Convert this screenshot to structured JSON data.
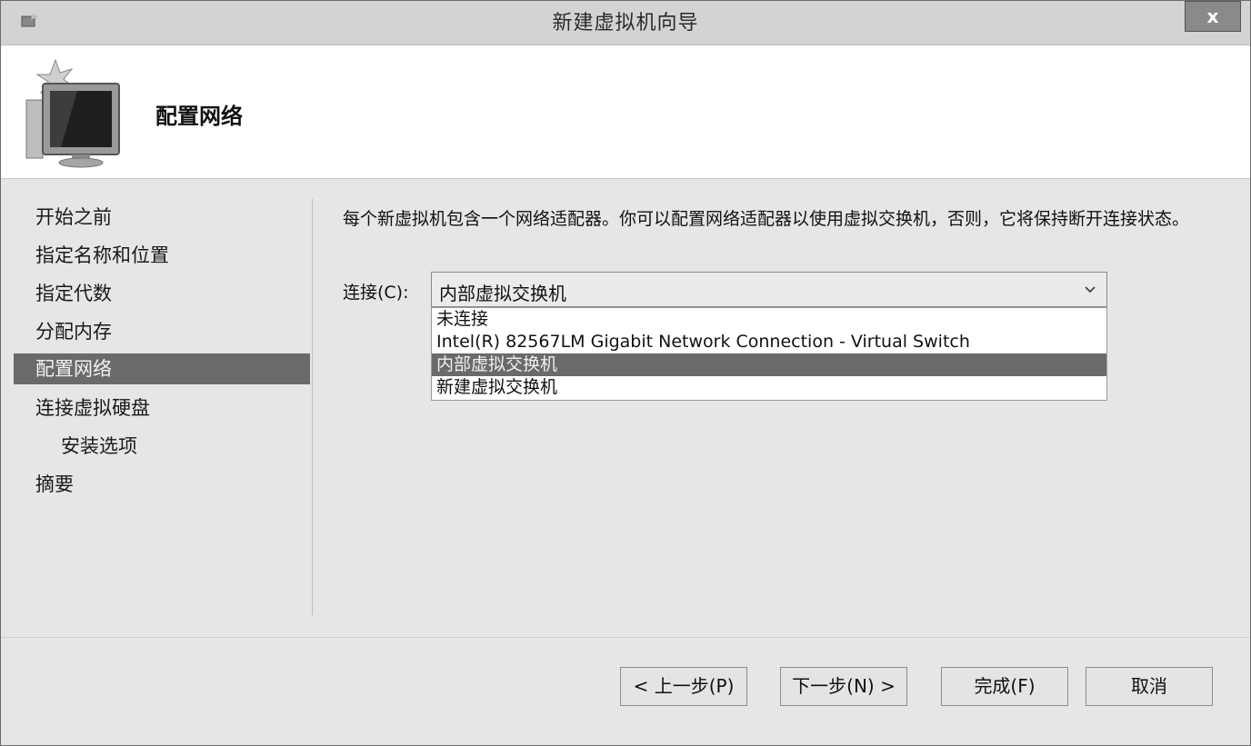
{
  "window": {
    "title": "新建虚拟机向导",
    "close_label": "x"
  },
  "header": {
    "title": "配置网络",
    "icon": "monitor-wizard-icon"
  },
  "nav": {
    "items": [
      {
        "label": "开始之前"
      },
      {
        "label": "指定名称和位置"
      },
      {
        "label": "指定代数"
      },
      {
        "label": "分配内存"
      },
      {
        "label": "配置网络",
        "active": true
      },
      {
        "label": "连接虚拟硬盘"
      },
      {
        "label": "安装选项"
      },
      {
        "label": "摘要"
      }
    ]
  },
  "main": {
    "description": "每个新虚拟机包含一个网络适配器。你可以配置网络适配器以使用虚拟交换机，否则，它将保持断开连接状态。",
    "connection_label": "连接(C):",
    "connection_value": "内部虚拟交换机",
    "options": [
      "未连接",
      "Intel(R) 82567LM Gigabit Network Connection - Virtual Switch",
      "内部虚拟交换机",
      "新建虚拟交换机"
    ],
    "selected_option": "内部虚拟交换机"
  },
  "buttons": {
    "previous": "< 上一步(P)",
    "next": "下一步(N) >",
    "finish": "完成(F)",
    "cancel": "取消"
  }
}
